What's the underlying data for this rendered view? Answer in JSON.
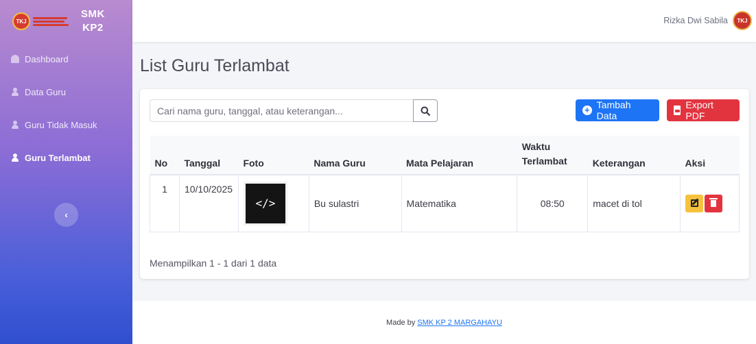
{
  "brand": {
    "name_line1": "SMK",
    "name_line2": "KP2",
    "logo_text": "TKJ"
  },
  "sidebar": {
    "items": [
      {
        "label": "Dashboard",
        "icon": "gauge-icon",
        "active": false
      },
      {
        "label": "Data Guru",
        "icon": "user-icon",
        "active": false
      },
      {
        "label": "Guru Tidak Masuk",
        "icon": "user-icon",
        "active": false
      },
      {
        "label": "Guru Terlambat",
        "icon": "user-icon",
        "active": true
      }
    ],
    "toggle_glyph": "‹"
  },
  "topbar": {
    "user_name": "Rizka Dwi Sabila",
    "avatar_text": "TKJ"
  },
  "page": {
    "title": "List Guru Terlambat"
  },
  "search": {
    "placeholder": "Cari nama guru, tanggal, atau keterangan...",
    "value": ""
  },
  "buttons": {
    "add_label": "Tambah Data",
    "pdf_label": "Export PDF"
  },
  "table": {
    "headers": [
      "No",
      "Tanggal",
      "Foto",
      "Nama Guru",
      "Mata Pelajaran",
      "Waktu Terlambat",
      "Keterangan",
      "Aksi"
    ],
    "rows": [
      {
        "no": "1",
        "tanggal": "10/10/2025",
        "foto_glyph": "</>",
        "nama": "Bu sulastri",
        "mapel": "Matematika",
        "waktu": "08:50",
        "keterangan": "macet di tol"
      }
    ]
  },
  "pagination": {
    "info": "Menampilkan 1 - 1 dari 1 data"
  },
  "footer": {
    "prefix": "Made by",
    "link_text": "SMK KP 2 MARGAHAYU"
  },
  "colors": {
    "primary": "#1d74f5",
    "danger": "#e2343f",
    "warning": "#f6c23e"
  }
}
